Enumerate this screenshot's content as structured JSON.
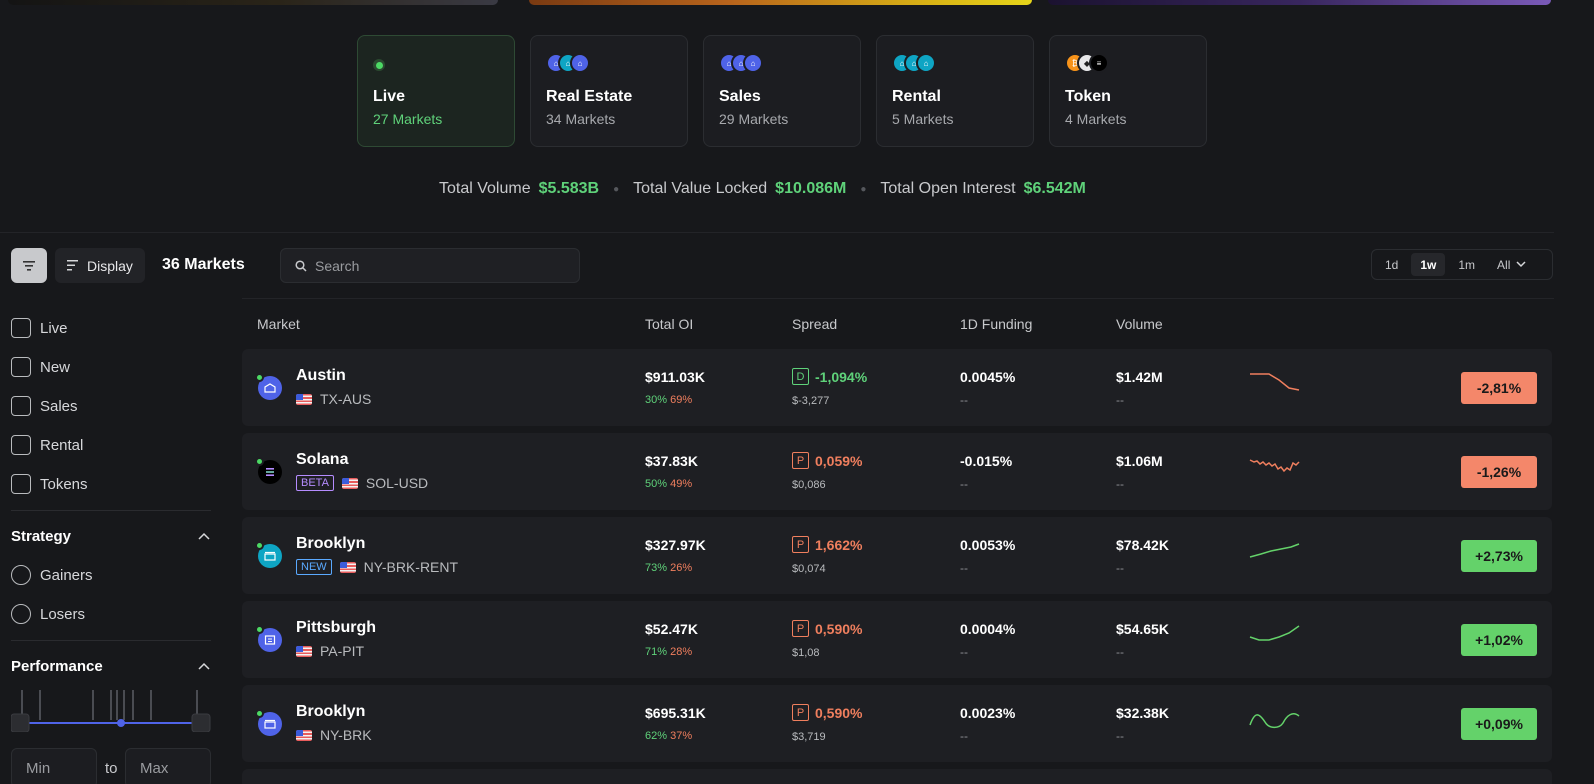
{
  "categories": [
    {
      "title": "Live",
      "sub": "27 Markets"
    },
    {
      "title": "Real Estate",
      "sub": "34 Markets"
    },
    {
      "title": "Sales",
      "sub": "29 Markets"
    },
    {
      "title": "Rental",
      "sub": "5 Markets"
    },
    {
      "title": "Token",
      "sub": "4 Markets"
    }
  ],
  "stats": [
    {
      "label": "Total Volume",
      "value": "$5.583B"
    },
    {
      "label": "Total Value Locked",
      "value": "$10.086M"
    },
    {
      "label": "Total Open Interest",
      "value": "$6.542M"
    }
  ],
  "toolbar": {
    "display_label": "Display",
    "count_label": "36 Markets",
    "search_placeholder": "Search",
    "ranges": [
      "1d",
      "1w",
      "1m",
      "All"
    ],
    "selected_range": "1w"
  },
  "filters": {
    "types": [
      "Live",
      "New",
      "Sales",
      "Rental",
      "Tokens"
    ],
    "strategy_title": "Strategy",
    "strategy": [
      "Gainers",
      "Losers"
    ],
    "performance_title": "Performance",
    "min_placeholder": "Min",
    "to_label": "to",
    "max_placeholder": "Max"
  },
  "table": {
    "headers": [
      "Market",
      "Total OI",
      "Spread",
      "1D Funding",
      "Volume"
    ],
    "rows": [
      {
        "name": "Austin",
        "symbol": "TX-AUS",
        "tag": "",
        "oi": "$911.03K",
        "long": "30%",
        "short": "69%",
        "spread_badge": "D",
        "spread": "-1,094%",
        "spread_sub": "$-3,277",
        "funding": "0.0045%",
        "funding_sub": "--",
        "volume": "$1.42M",
        "volume_sub": "--",
        "change": "-2,81%",
        "direction": "down",
        "avatar_color": "#4f63e8"
      },
      {
        "name": "Solana",
        "symbol": "SOL-USD",
        "tag": "BETA",
        "oi": "$37.83K",
        "long": "50%",
        "short": "49%",
        "spread_badge": "P",
        "spread": "0,059%",
        "spread_sub": "$0,086",
        "funding": "-0.015%",
        "funding_sub": "--",
        "volume": "$1.06M",
        "volume_sub": "--",
        "change": "-1,26%",
        "direction": "down",
        "avatar_color": "#000000"
      },
      {
        "name": "Brooklyn",
        "symbol": "NY-BRK-RENT",
        "tag": "NEW",
        "oi": "$327.97K",
        "long": "73%",
        "short": "26%",
        "spread_badge": "P",
        "spread": "1,662%",
        "spread_sub": "$0,074",
        "funding": "0.0053%",
        "funding_sub": "--",
        "volume": "$78.42K",
        "volume_sub": "--",
        "change": "+2,73%",
        "direction": "up",
        "avatar_color": "#0ea5c4"
      },
      {
        "name": "Pittsburgh",
        "symbol": "PA-PIT",
        "tag": "",
        "oi": "$52.47K",
        "long": "71%",
        "short": "28%",
        "spread_badge": "P",
        "spread": "0,590%",
        "spread_sub": "$1,08",
        "funding": "0.0004%",
        "funding_sub": "--",
        "volume": "$54.65K",
        "volume_sub": "--",
        "change": "+1,02%",
        "direction": "up",
        "avatar_color": "#4f63e8"
      },
      {
        "name": "Brooklyn",
        "symbol": "NY-BRK",
        "tag": "",
        "oi": "$695.31K",
        "long": "62%",
        "short": "37%",
        "spread_badge": "P",
        "spread": "0,590%",
        "spread_sub": "$3,719",
        "funding": "0.0023%",
        "funding_sub": "--",
        "volume": "$32.38K",
        "volume_sub": "--",
        "change": "+0,09%",
        "direction": "up",
        "avatar_color": "#4f63e8"
      }
    ]
  },
  "colors": {
    "positive": "#64d26a",
    "negative": "#f4876a",
    "background": "#17181b",
    "row": "#1e1f23"
  }
}
